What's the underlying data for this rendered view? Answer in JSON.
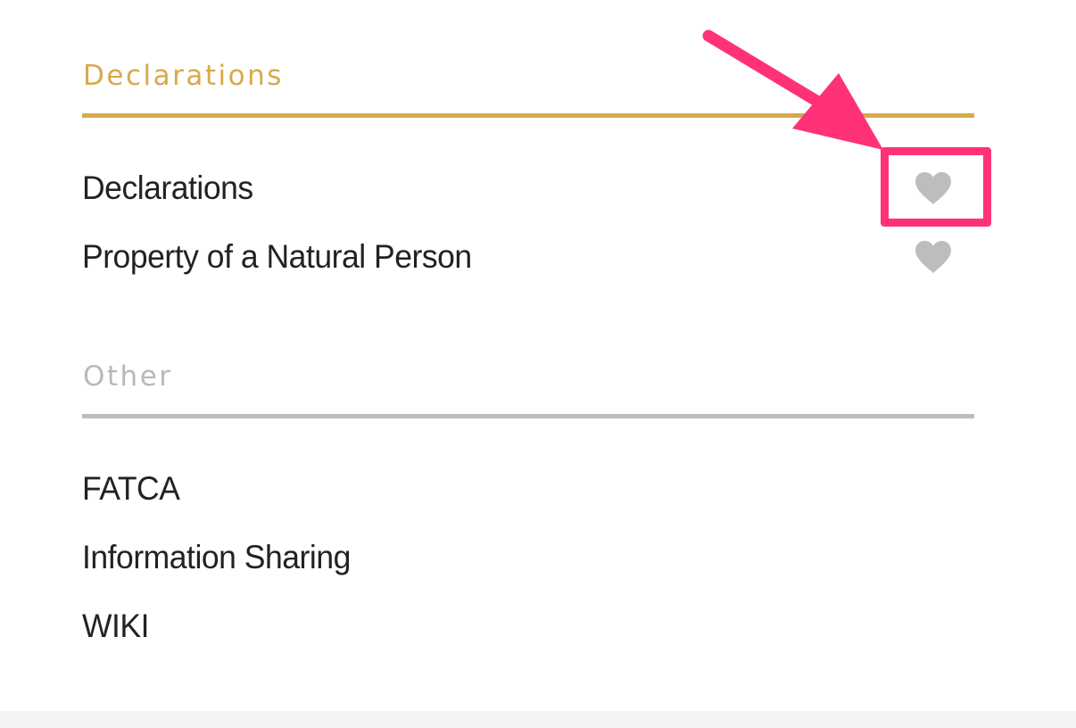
{
  "colors": {
    "declarations_accent": "#d8a94b",
    "other_heading": "#b9b9b9",
    "other_rule": "#bdbdbd",
    "heart": "#bdbdbd",
    "annotation": "#ff3277"
  },
  "sections": [
    {
      "heading": "Declarations",
      "items": [
        {
          "label": "Declarations",
          "favorite_icon": "heart-icon"
        },
        {
          "label": "Property of a Natural Person",
          "favorite_icon": "heart-icon"
        }
      ]
    },
    {
      "heading": "Other",
      "items": [
        {
          "label": "FATCA"
        },
        {
          "label": "Information Sharing"
        },
        {
          "label": "WIKI"
        }
      ]
    }
  ]
}
